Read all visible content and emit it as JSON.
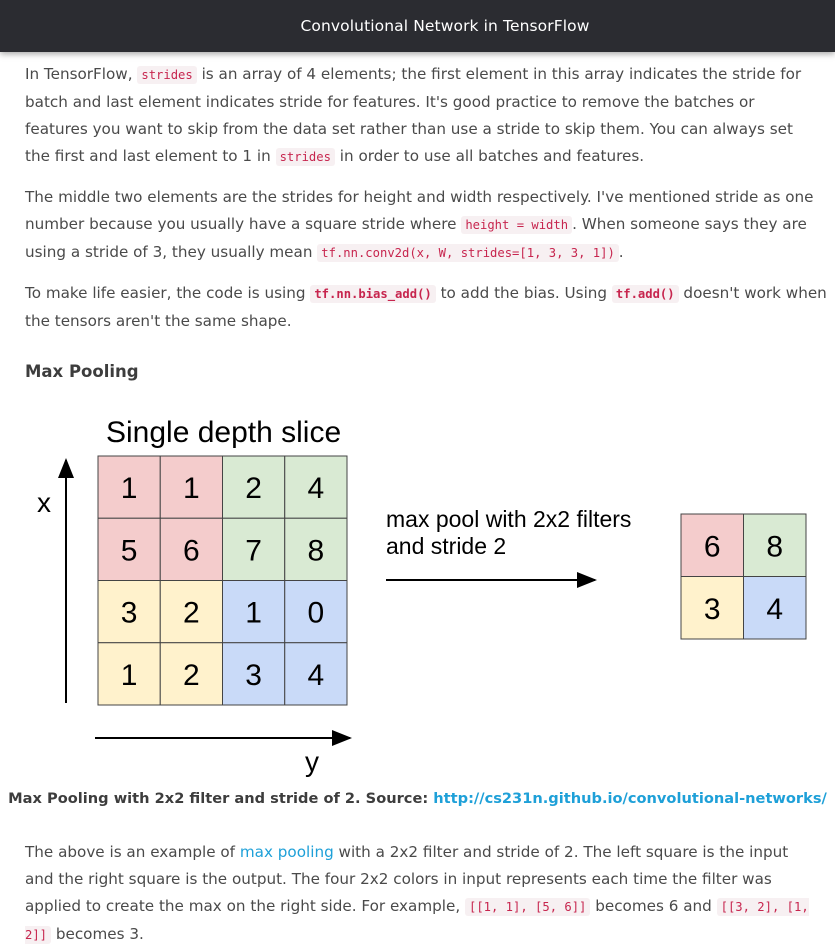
{
  "header": {
    "title": "Convolutional Network in TensorFlow"
  },
  "paragraphs": {
    "p1": {
      "t1": "In TensorFlow, ",
      "c1": "strides",
      "t2": " is an array of 4 elements; the first element in this array indicates the stride for batch and last element indicates stride for features. It's good practice to remove the batches or features you want to skip from the data set rather than use a stride to skip them. You can always set the first and last element to 1 in ",
      "c2": "strides",
      "t3": " in order to use all batches and features."
    },
    "p2": {
      "t1": "The middle two elements are the strides for height and width respectively. I've mentioned stride as one number because you usually have a square stride where ",
      "c1": "height = width",
      "t2": ". When someone says they are using a stride of 3, they usually mean ",
      "c2": "tf.nn.conv2d(x, W, strides=[1, 3, 3, 1])",
      "t3": "."
    },
    "p3": {
      "t1": "To make life easier, the code is using ",
      "c1": "tf.nn.bias_add()",
      "t2": " to add the bias. Using ",
      "c2": "tf.add()",
      "t3": " doesn't work when the tensors aren't the same shape."
    },
    "p4": {
      "t1": "The above is an example of ",
      "link": "max pooling",
      "t2": " with a 2x2 filter and stride of 2. The left square is the input and the right square is the output. The four 2x2 colors in input represents each time the filter was applied to create the max on the right side. For example, ",
      "c1": "[[1, 1], [5, 6]]",
      "t3": " becomes 6 and ",
      "c2": "[[3, 2], [1, 2]]",
      "t4": " becomes 3."
    }
  },
  "section": {
    "heading": "Max Pooling"
  },
  "figure": {
    "title": "Single depth slice",
    "x_axis": "x",
    "y_axis": "y",
    "op_line1": "max pool with 2x2 filters",
    "op_line2": "and stride 2",
    "input": [
      "1",
      "1",
      "2",
      "4",
      "5",
      "6",
      "7",
      "8",
      "3",
      "2",
      "1",
      "0",
      "1",
      "2",
      "3",
      "4"
    ],
    "output": [
      "6",
      "8",
      "3",
      "4"
    ],
    "colors": {
      "pink": "#f4cccc",
      "green": "#d9ead3",
      "yellow": "#fff2cc",
      "blue": "#c9daf8"
    }
  },
  "caption": {
    "text": "Max Pooling with 2x2 filter and stride of 2. Source: ",
    "link": "http://cs231n.github.io/convolutional-networks/"
  }
}
